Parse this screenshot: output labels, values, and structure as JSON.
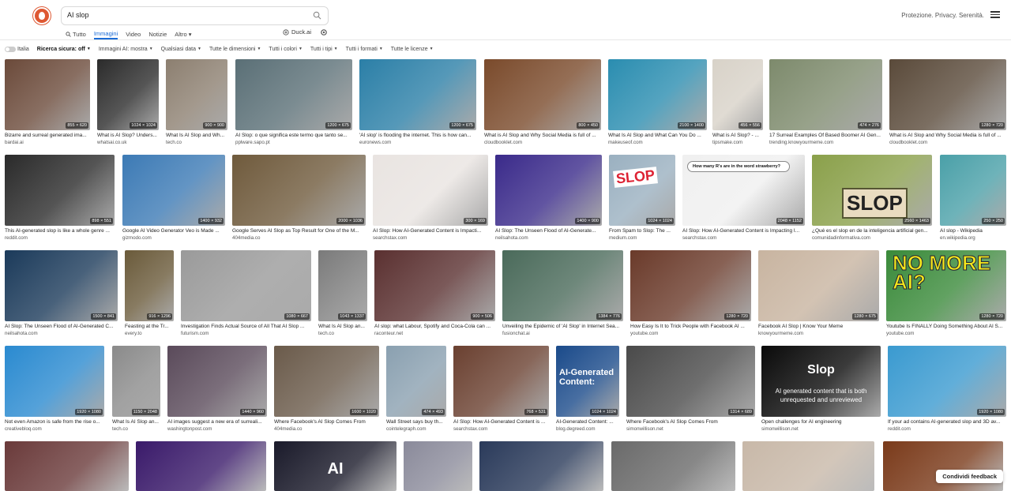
{
  "header": {
    "query": "AI slop",
    "tagline": "Protezione. Privacy. Serenità."
  },
  "tabs": [
    {
      "label": "Tutto",
      "icon": "search-icon",
      "active": false
    },
    {
      "label": "Immagini",
      "active": true
    },
    {
      "label": "Video",
      "active": false
    },
    {
      "label": "Notizie",
      "active": false
    },
    {
      "label": "Altro ▾",
      "active": false
    }
  ],
  "duck_ai": "Duck.ai",
  "filters": {
    "region": "Italia",
    "safe_search": "Ricerca sicura: off",
    "ai_images": "Immagini AI: mostra",
    "date": "Qualsiasi data",
    "size": "Tutte le dimensioni",
    "color": "Tutti i colori",
    "type": "Tutti i tipi",
    "format": "Tutti i formati",
    "license": "Tutte le licenze"
  },
  "feedback": "Condividi feedback",
  "results": [
    {
      "dims": "855 × 620",
      "caption": "Bizarre and surreal generated ima...",
      "source": "bardai.ai",
      "color": "#6b4a3a"
    },
    {
      "dims": "1024 × 1024",
      "caption": "What is AI Slop? Unders...",
      "source": "whatsai.co.uk",
      "color": "#2b2b2b"
    },
    {
      "dims": "900 × 900",
      "caption": "What Is AI Slop and Wh...",
      "source": "tech.co",
      "color": "#8c7f70"
    },
    {
      "dims": "1200 × 675",
      "caption": "AI Slop: o que significa este termo que tanto se...",
      "source": "pplware.sapo.pt",
      "color": "#5a6f76"
    },
    {
      "dims": "1200 × 675",
      "caption": "'AI slop' is flooding the internet. This is how can...",
      "source": "euronews.com",
      "color": "#2b7fa7"
    },
    {
      "dims": "800 × 450",
      "caption": "What is AI Slop and Why Social Media is full of ...",
      "source": "cloudbooklet.com",
      "color": "#7a4a2b"
    },
    {
      "dims": "2100 × 1400",
      "caption": "What Is AI Slop and What Can You Do ...",
      "source": "makeuseof.com",
      "color": "#2a8db0"
    },
    {
      "dims": "456 × 556",
      "caption": "What is AI Slop? - ...",
      "source": "tipsmake.com",
      "color": "#d8d2c8"
    },
    {
      "dims": "474 × 276",
      "caption": "17 Surreal Examples Of Based Boomer AI Gen...",
      "source": "trending.knowyourmeme.com",
      "color": "#7d8a6c"
    },
    {
      "dims": "1280 × 720",
      "caption": "What is AI Slop and Why Social Media is full of ...",
      "source": "cloudbooklet.com",
      "color": "#5a4a3a"
    },
    {
      "dims": "898 × 551",
      "caption": "This AI-generated slop is like a whole genre ...",
      "source": "reddit.com",
      "color": "#2a2a2a"
    },
    {
      "dims": "1400 × 932",
      "caption": "Google AI Video Generator Veo is Made ...",
      "source": "gizmodo.com",
      "color": "#3c7ab5"
    },
    {
      "dims": "2000 × 1036",
      "caption": "Google Serves AI Slop as Top Result for One of the M...",
      "source": "404media.co",
      "color": "#6f5a3c"
    },
    {
      "dims": "300 × 169",
      "caption": "AI Slop: How AI-Generated Content is Impacti...",
      "source": "searchstax.com",
      "color": "#e9e4e1"
    },
    {
      "dims": "1400 × 900",
      "caption": "AI Slop: The Unseen Flood of AI-Generate...",
      "source": "neilsahota.com",
      "color": "#3a2a8a"
    },
    {
      "dims": "1024 × 1024",
      "caption": "From Spam to Slop: The ...",
      "source": "medium.com",
      "color": "#9ab0c0"
    },
    {
      "dims": "2048 × 1152",
      "caption": "AI Slop: How AI-Generated Content is Impacting I...",
      "source": "searchstax.com",
      "color": "#f0f0f0"
    },
    {
      "dims": "2560 × 1463",
      "caption": "¿Qué es el slop en de la inteligencia artificial gen...",
      "source": "comunidadinformativa.com",
      "color": "#8aa04a"
    },
    {
      "dims": "250 × 250",
      "caption": "AI slop - Wikipedia",
      "source": "en.wikipedia.org",
      "color": "#4aa0a8"
    },
    {
      "dims": "1500 × 841",
      "caption": "AI Slop: The Unseen Flood of AI-Generated C...",
      "source": "neilsahota.com",
      "color": "#1b3a5a"
    },
    {
      "dims": "916 × 1296",
      "caption": "Feasting at the Tr...",
      "source": "every.to",
      "color": "#6a5a3a"
    },
    {
      "dims": "1080 × 667",
      "caption": "Investigation Finds Actual Source of All That AI Slop ...",
      "source": "futurism.com",
      "color": "#9a9a9a"
    },
    {
      "dims": "1043 × 1337",
      "caption": "What Is AI Slop an...",
      "source": "tech.co",
      "color": "#7a7a7a"
    },
    {
      "dims": "900 × 506",
      "caption": "AI slop: what Labour, Spotify and Coca-Cola can ...",
      "source": "raconteur.net",
      "color": "#5a3030"
    },
    {
      "dims": "1384 × 776",
      "caption": "Unveiling the Epidemic of 'AI Slop' in Internet Sea...",
      "source": "fusionchat.ai",
      "color": "#4a6a5a"
    },
    {
      "dims": "1280 × 720",
      "caption": "How Easy Is It to Trick People with Facebook AI ...",
      "source": "youtube.com",
      "color": "#6a3a2a"
    },
    {
      "dims": "1280 × 675",
      "caption": "Facebook AI Slop | Know Your Meme",
      "source": "knowyourmeme.com",
      "color": "#c8b4a0"
    },
    {
      "dims": "1280 × 720",
      "caption": "Youtube Is FINALLY Doing Something About AI S...",
      "source": "youtube.com",
      "color": "#3a8a3a"
    },
    {
      "dims": "1920 × 1080",
      "caption": "Not even Amazon is safe from the rise o...",
      "source": "creativebloq.com",
      "color": "#2a8ad0"
    },
    {
      "dims": "1150 × 2048",
      "caption": "What Is AI Slop an...",
      "source": "tech.co",
      "color": "#8a8a8a"
    },
    {
      "dims": "1440 × 960",
      "caption": "AI images suggest a new era of surreali...",
      "source": "washingtonpost.com",
      "color": "#5a4a5a"
    },
    {
      "dims": "1600 × 1020",
      "caption": "Where Facebook's AI Slop Comes From",
      "source": "404media.co",
      "color": "#6a5a4a"
    },
    {
      "dims": "474 × 493",
      "caption": "Wall Street says buy th...",
      "source": "cointelegraph.com",
      "color": "#8aa0b0"
    },
    {
      "dims": "768 × 531",
      "caption": "AI Slop: How AI-Generated Content is ...",
      "source": "searchstax.com",
      "color": "#6a4030"
    },
    {
      "dims": "1024 × 1024",
      "caption": "AI-Generated Content: ...",
      "source": "blog.degreed.com",
      "color": "#1a4a8a"
    },
    {
      "dims": "1314 × 689",
      "caption": "Where Facebook's AI Slop Comes From",
      "source": "simonwillison.net",
      "color": "#4a4a4a"
    },
    {
      "dims": "",
      "caption": "Open challenges for AI engineering",
      "source": "simonwillison.net",
      "color": "#0a0a0a"
    },
    {
      "dims": "1920 × 1080",
      "caption": "If your ad contains AI-generated slop and 3D av...",
      "source": "reddit.com",
      "color": "#3a9ad0"
    }
  ],
  "tile_text": {
    "slop_sign": "SLOP",
    "strawberry": "How many R's are in the word strawberry?",
    "no_more_ai": "NO MORE AI?",
    "ai_content": "AI-Generated Content:",
    "slop_title": "Slop",
    "slop_sub": "AI generated content that is both unrequested and unreviewed",
    "ai_glow": "AI"
  }
}
